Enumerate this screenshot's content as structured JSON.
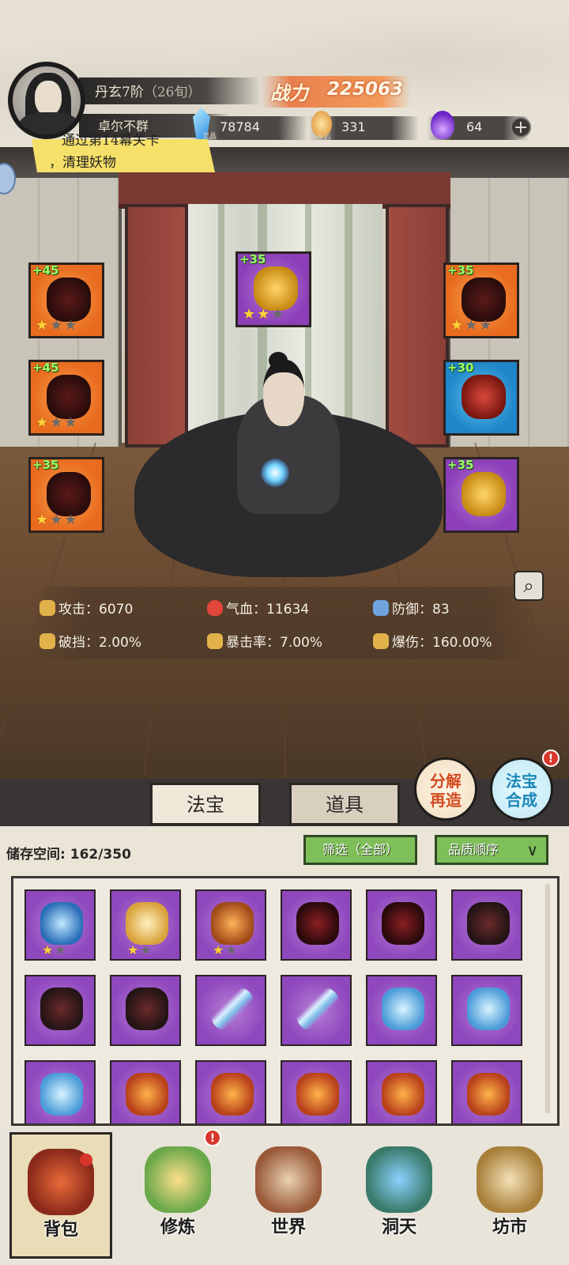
{
  "player": {
    "rank": "丹玄7阶",
    "rank_sub": "（26旬）",
    "name": "卓尔不群",
    "power_label": "战力",
    "power": "225063"
  },
  "resources": [
    {
      "icon": "spirit-crystal-icon",
      "label": "灵晶",
      "value": "78784"
    },
    {
      "icon": "creation-stone-icon",
      "label": "造化石",
      "value": "331"
    },
    {
      "icon": "purple-flame-icon",
      "label": "",
      "value": "64"
    }
  ],
  "quest": {
    "line1": "通过第14幕关卡",
    "line2": "，清理妖物"
  },
  "equipment": {
    "left": [
      {
        "level": "+45",
        "stars": 1,
        "quality": "orange"
      },
      {
        "level": "+45",
        "stars": 1,
        "quality": "orange"
      },
      {
        "level": "+35",
        "stars": 1,
        "quality": "orange"
      }
    ],
    "center": {
      "level": "+35",
      "stars": 2,
      "quality": "purple"
    },
    "right": [
      {
        "level": "+35",
        "stars": 1,
        "quality": "orange"
      },
      {
        "level": "+30",
        "stars": 0,
        "quality": "blue"
      },
      {
        "level": "+35",
        "stars": 0,
        "quality": "purple"
      }
    ]
  },
  "stats": [
    {
      "label": "攻击：",
      "value": "6070",
      "icon": "sword-icon"
    },
    {
      "label": "气血：",
      "value": "11634",
      "icon": "heart-icon"
    },
    {
      "label": "防御：",
      "value": "83",
      "icon": "shield-icon"
    },
    {
      "label": "破挡：",
      "value": "2.00%",
      "icon": "break-block-icon"
    },
    {
      "label": "暴击率：",
      "value": "7.00%",
      "icon": "crit-rate-icon"
    },
    {
      "label": "爆伤：",
      "value": "160.00%",
      "icon": "crit-damage-icon"
    }
  ],
  "tabs": {
    "treasure": "法宝",
    "items": "道具"
  },
  "actions": {
    "decompose_line1": "分解",
    "decompose_line2": "再造",
    "synth_line1": "法宝",
    "synth_line2": "合成",
    "badge": "!"
  },
  "storage": {
    "label": "储存空间:",
    "value": "162/350"
  },
  "filter": {
    "label": "筛选（全部）",
    "sort": "品质顺序",
    "sort_icon": "chevron-down-icon"
  },
  "inventory": [
    {
      "art": "blue-gauntlet",
      "stars": 1
    },
    {
      "art": "dragon-armor",
      "stars": 1
    },
    {
      "art": "sun-emblem",
      "stars": 1
    },
    {
      "art": "dark-blade",
      "stars": 0
    },
    {
      "art": "dark-blade",
      "stars": 0
    },
    {
      "art": "shadow-wheel",
      "stars": 0
    },
    {
      "art": "shadow-wheel",
      "stars": 0
    },
    {
      "art": "shadow-wheel",
      "stars": 0
    },
    {
      "art": "ice-sword",
      "stars": 0
    },
    {
      "art": "ice-sword",
      "stars": 0
    },
    {
      "art": "frost-bow",
      "stars": 0
    },
    {
      "art": "frost-bow",
      "stars": 0
    },
    {
      "art": "frost-bow",
      "stars": 0
    },
    {
      "art": "fire-gourd",
      "stars": 0
    },
    {
      "art": "fire-gourd",
      "stars": 0
    },
    {
      "art": "fire-gourd",
      "stars": 0
    },
    {
      "art": "fire-gourd",
      "stars": 0
    },
    {
      "art": "fire-gourd",
      "stars": 0
    }
  ],
  "nav": [
    {
      "label": "背包",
      "icon": "bag-icon",
      "active": true
    },
    {
      "label": "修炼",
      "icon": "lotus-icon",
      "badge": "!"
    },
    {
      "label": "世界",
      "icon": "scroll-map-icon"
    },
    {
      "label": "洞天",
      "icon": "portal-icon"
    },
    {
      "label": "坊市",
      "icon": "market-icon"
    }
  ],
  "colors": {
    "orange_slot": "#e96b1f",
    "purple_slot": "#8c3fb8",
    "blue_slot": "#1f86c8",
    "level_text": "#9cff6a",
    "star": "#ffd23a",
    "quest_banner": "#f5e06a",
    "filter_button": "#7fbf5a"
  }
}
